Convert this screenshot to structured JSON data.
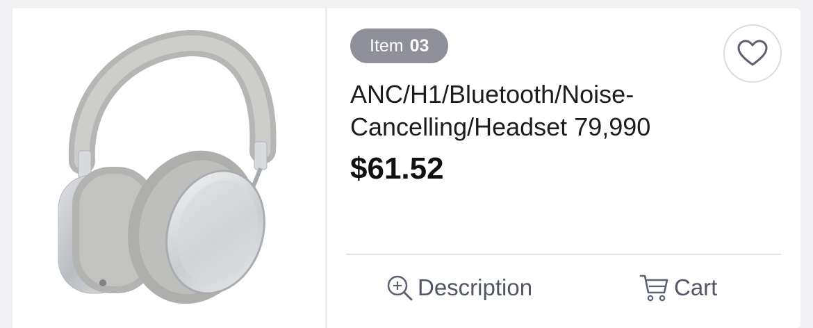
{
  "product": {
    "badge_prefix": "Item",
    "badge_number": "03",
    "title": "ANC/H1/Bluetooth/Noise-Cancelling/Headset 79,990",
    "price": "$61.52",
    "image_icon": "headphones-image"
  },
  "actions": {
    "favorite_icon": "heart-icon",
    "description_label": "Description",
    "description_icon": "zoom-plus-icon",
    "cart_label": "Cart",
    "cart_icon": "cart-icon"
  },
  "colors": {
    "badge_bg": "#8e8f99",
    "action_text": "#505667",
    "price_text": "#111111"
  }
}
